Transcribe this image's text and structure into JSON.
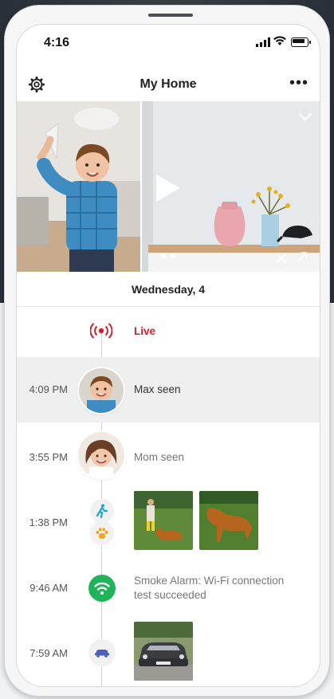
{
  "status_bar": {
    "time": "4:16"
  },
  "header": {
    "title": "My Home",
    "more_label": "•••"
  },
  "camera_strip": {
    "active_page": 1,
    "pages": 2
  },
  "date_header": "Wednesday, 4",
  "timeline": [
    {
      "time": "",
      "label": "Live",
      "icon": "live-broadcast-icon",
      "color": "#d21f2b"
    },
    {
      "time": "4:09 PM",
      "label": "Max seen",
      "icon": "avatar-max",
      "selected": true
    },
    {
      "time": "3:55 PM",
      "label": "Mom seen",
      "icon": "avatar-mom"
    },
    {
      "time": "1:38 PM",
      "label": "",
      "icons": [
        "person-walking-icon",
        "paw-icon"
      ],
      "thumbnails": [
        "dog-with-child-thumbnail",
        "golden-retriever-thumbnail"
      ]
    },
    {
      "time": "9:46 AM",
      "label": "Smoke Alarm: Wi-Fi connection test succeeded",
      "icon": "wifi-icon",
      "color": "#1fb45a"
    },
    {
      "time": "7:59 AM",
      "label": "",
      "icon": "car-icon",
      "thumbnails": [
        "car-thumbnail"
      ]
    }
  ],
  "colors": {
    "accent_red": "#d21f2b",
    "wifi_green": "#1fb45a",
    "selected_row": "#efeff0"
  }
}
